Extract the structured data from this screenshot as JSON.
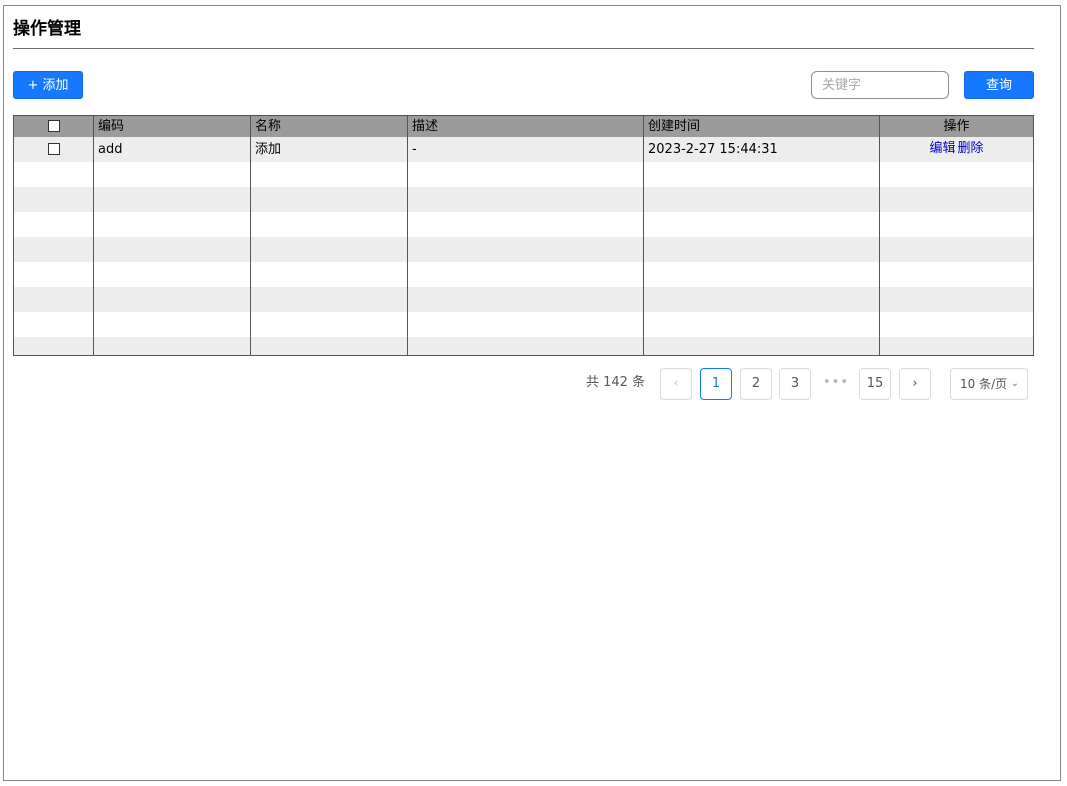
{
  "page": {
    "title": "操作管理"
  },
  "toolbar": {
    "add_label": "+ 添加",
    "search_placeholder": "关键字",
    "search_value": "",
    "query_label": "查询"
  },
  "table": {
    "columns": [
      "编码",
      "名称",
      "描述",
      "创建时间",
      "操作"
    ],
    "rows": [
      {
        "code": "add",
        "name": "添加",
        "description": "-",
        "created_at": "2023-2-27 15:44:31",
        "actions": [
          "编辑",
          "删除"
        ]
      }
    ],
    "empty_row_count": 8
  },
  "pagination": {
    "total_label": "共 142 条",
    "prev_icon": "chevron-left-icon",
    "next_icon": "chevron-right-icon",
    "pages": [
      "1",
      "2",
      "3"
    ],
    "ellipsis": "•••",
    "last_page": "15",
    "current_page": "1",
    "page_size_label": "10 条/页"
  },
  "colors": {
    "primary": "#1677ff",
    "header_bg": "#9b9b9b",
    "stripe_bg": "#ededed",
    "link": "#0000cc"
  }
}
